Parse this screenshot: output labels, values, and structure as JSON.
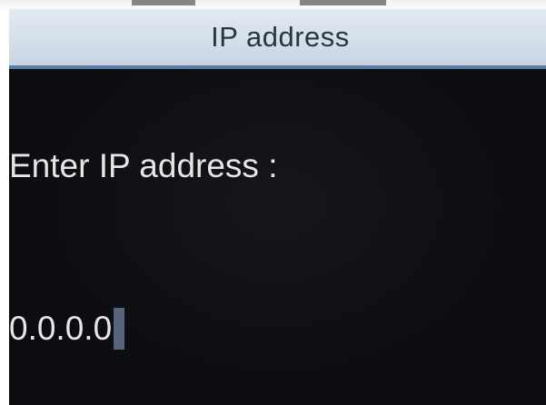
{
  "dialog": {
    "title": "IP address",
    "prompt": "Enter IP address :",
    "ip_field": {
      "value": "0.0.0.0"
    }
  },
  "colors": {
    "title_bar_bg": "#d4dfea",
    "title_bar_border": "#5a7c9f",
    "screen_bg": "#0c0d10",
    "text": "#e6e6e6",
    "caret": "#56657a"
  }
}
